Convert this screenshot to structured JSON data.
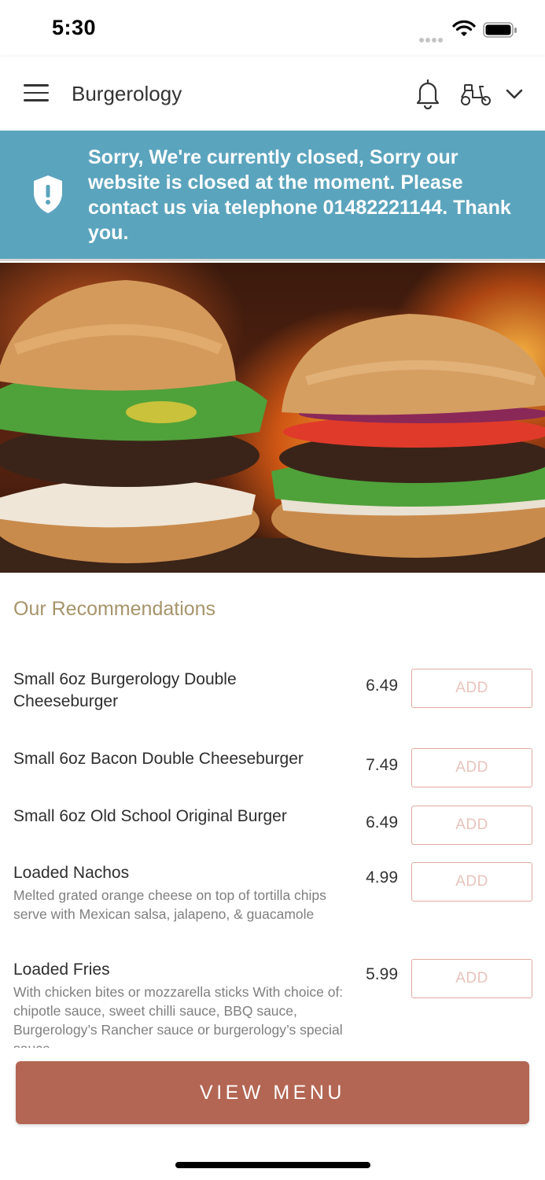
{
  "status_bar": {
    "time": "5:30"
  },
  "header": {
    "title": "Burgerology",
    "icons": [
      "menu-icon",
      "bell-icon",
      "scooter-icon",
      "chevron-down-icon"
    ]
  },
  "banner": {
    "icon": "shield-alert-icon",
    "message": "Sorry, We're currently closed, Sorry our website is closed at the moment. Please contact us via telephone 01482221144. Thank you.",
    "background_color": "#5ba4bd"
  },
  "hero": {
    "image": "two burgers with flames"
  },
  "recommendations": {
    "title": "Our Recommendations",
    "add_label": "ADD",
    "items": [
      {
        "name": "Small 6oz Burgerology Double Cheeseburger",
        "description": "",
        "price": "6.49"
      },
      {
        "name": "Small 6oz Bacon Double Cheeseburger",
        "description": "",
        "price": "7.49"
      },
      {
        "name": "Small 6oz Old School Original Burger",
        "description": "",
        "price": "6.49"
      },
      {
        "name": "Loaded Nachos",
        "description": "Melted grated orange cheese on top of tortilla chips serve with Mexican salsa, jalapeno, & guacamole",
        "price": "4.99"
      },
      {
        "name": "Loaded Fries",
        "description": "With chicken bites or mozzarella sticks With choice of: chipotle sauce, sweet chilli sauce, BBQ sauce, Burgerology’s Rancher sauce or burgerology’s special sauce",
        "price": "5.99"
      }
    ]
  },
  "view_menu": {
    "label": "VIEW MENU",
    "color": "#b36653"
  },
  "colors": {
    "accent": "#b36653",
    "section_title": "#a6946a",
    "add_border": "#e0a9a1"
  }
}
